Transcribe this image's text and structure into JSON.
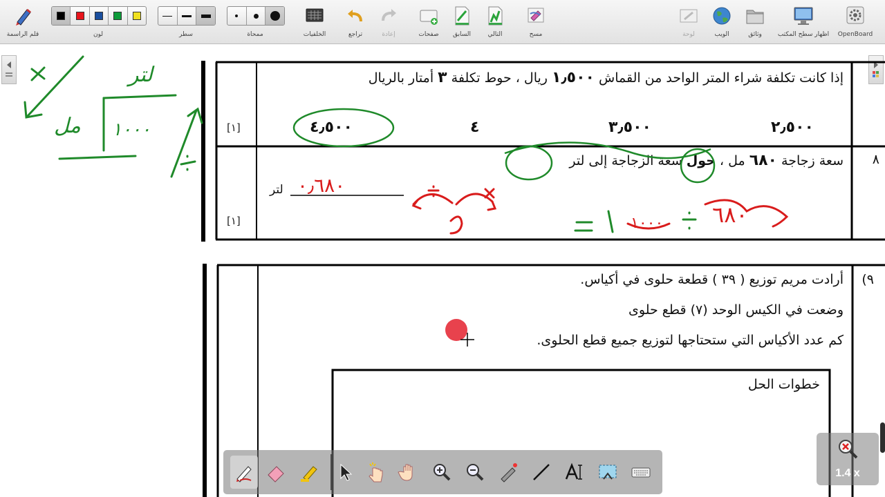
{
  "toolbar": {
    "right_group": {
      "pen_label": "قلم الراسمة",
      "color_label": "لون",
      "line_label": "سطر",
      "eraser_label": "ممحاة",
      "backgrounds_label": "الخلفيات",
      "undo_label": "تراجع",
      "redo_label": "إعادة",
      "pages_label": "صفحات",
      "previous_label": "السابق",
      "next_label": "التالي",
      "clear_label": "مسح"
    },
    "left_group": {
      "board_label": "لوحة",
      "web_label": "الويب",
      "documents_label": "وثائق",
      "desktop_label": "اظهار سطح المكتب",
      "app_label": "OpenBoard"
    },
    "colors": [
      "#000000",
      "#e8141b",
      "#1a4f9e",
      "#0d9b3a",
      "#f0e020"
    ]
  },
  "question7": {
    "text": "إذا كانت تكلفة شراء المتر الواحد من القماش",
    "price": "١٫٥٠٠",
    "text2": "ريال ، حوط تكلفة",
    "count": "٣",
    "text3": "أمتار بالريال",
    "options": [
      "٤٫٥٠٠",
      "٤",
      "٣٫٥٠٠",
      "٢٫٥٠٠"
    ],
    "mark": "[١]"
  },
  "question8": {
    "number": "٨",
    "text_a": "سعة زجاجة",
    "value": "٦٨٠",
    "text_b": "مل ،",
    "bold_word": "حول",
    "text_c": "سعة الزجاجة إلى لتر",
    "unit": "لتر",
    "mark": "[١]"
  },
  "question9": {
    "number": "٩)",
    "line1": "أرادت مريم توزيع ( ٣٩ ) قطعة حلوى في أكياس.",
    "line2": "وضعت في الكيس الوحد (٧) قطع حلوى",
    "line3": "كم عدد الأكياس التي ستحتاجها لتوزيع جميع قطع الحلوى.",
    "steps_label": "خطوات الحل"
  },
  "annotations": {
    "green_unit": "لتر",
    "green_ml": "مل",
    "green_thousand": "١٠٠٠",
    "red_answer": "٠٫٦٨٠",
    "red_parts": [
      "١٠٠٠",
      "٦٨٠"
    ]
  },
  "palette": {
    "tools": [
      "pen-tool",
      "eraser-tool",
      "marker-tool",
      "selector-tool",
      "interact-tool",
      "hand-tool",
      "zoom-in-tool",
      "zoom-out-tool",
      "laser-pointer-tool",
      "line-tool",
      "text-tool",
      "capture-tool",
      "keyboard-tool"
    ],
    "selected": "pen-tool"
  },
  "zoom": {
    "level": "1.4 x"
  }
}
